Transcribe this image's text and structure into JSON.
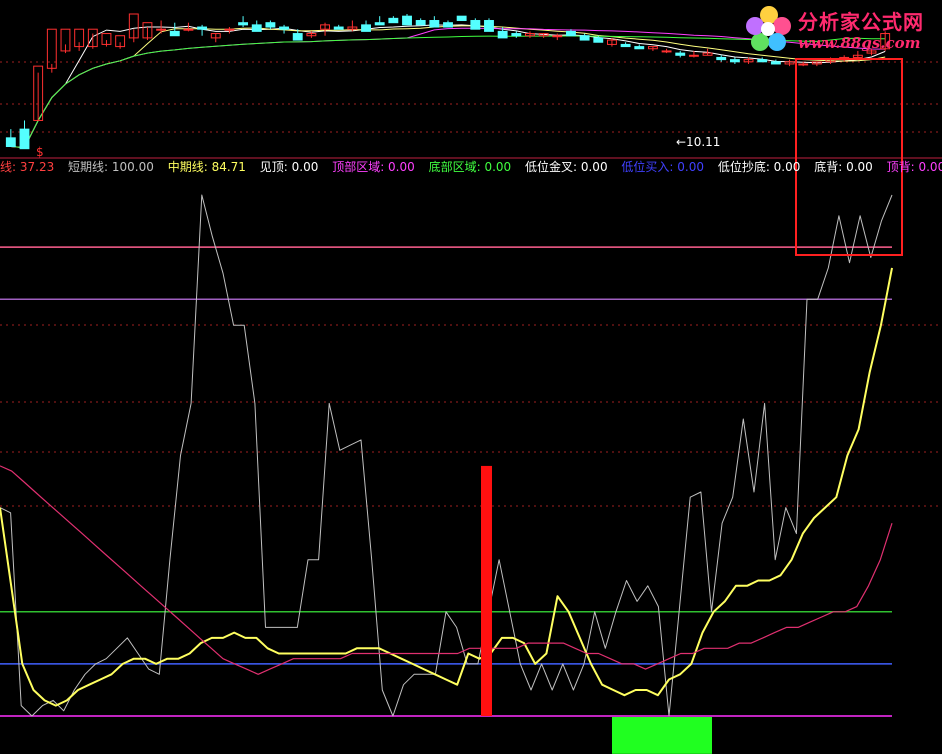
{
  "logo": {
    "title": "分析家公式网",
    "url": "www.88gs.com"
  },
  "colors": {
    "background": "#000000",
    "up_candle": "#ff3030",
    "down_candle": "#54ffff",
    "ma_white": "#ffffff",
    "ma_yellow": "#ffff80",
    "ma_magenta": "#ff40ff",
    "ma_green": "#40ff40",
    "red_box": "#ff2020",
    "separator": "#c02040",
    "grid_dots": "#a02020",
    "line_gray": "#c0c0c0",
    "line_yellow": "#ffff60",
    "line_pink": "#e03070",
    "hline_pink": "#ff6090",
    "hline_purple": "#a060c0",
    "hline_green": "#30c030",
    "hline_blue": "#4060ff",
    "hline_magenta": "#ff30ff",
    "signal_red": "#ff1010",
    "signal_green": "#20ff20"
  },
  "price_panel": {
    "marker_text": "$",
    "low_label": "←10.11"
  },
  "legend": [
    {
      "text": "线: 37.23",
      "color": "#ff4040"
    },
    {
      "text": "短期线: 100.00",
      "color": "#c0c0c0"
    },
    {
      "text": "中期线: 84.71",
      "color": "#ffff60"
    },
    {
      "text": "见顶: 0.00",
      "color": "#ffffff"
    },
    {
      "text": "顶部区域: 0.00",
      "color": "#ff40ff"
    },
    {
      "text": "底部区域: 0.00",
      "color": "#40ff40"
    },
    {
      "text": "低位金叉: 0.00",
      "color": "#ffffff"
    },
    {
      "text": "低位买入: 0.00",
      "color": "#4040ff"
    },
    {
      "text": "低位抄底: 0.00",
      "color": "#ffffff"
    },
    {
      "text": "底背: 0.00",
      "color": "#ffffff"
    },
    {
      "text": "顶背: 0.00",
      "color": "#ff40ff"
    }
  ],
  "chart_data": [
    {
      "type": "candlestick",
      "title": "",
      "notes": "price panel, no visible axis labels",
      "candles": [
        [
          50,
          54,
          49,
          46
        ],
        [
          54,
          58,
          53,
          45
        ],
        [
          58,
          80,
          58,
          83
        ],
        [
          82,
          84,
          80,
          100
        ],
        [
          90,
          93,
          89,
          100
        ],
        [
          92,
          94,
          90,
          100
        ],
        [
          92,
          98,
          91,
          100
        ],
        [
          93,
          95,
          92,
          98
        ],
        [
          92,
          94,
          91,
          97
        ],
        [
          96,
          100,
          94,
          107
        ],
        [
          96,
          101,
          95,
          103
        ],
        [
          100,
          104,
          98,
          100
        ],
        [
          99,
          103,
          98,
          97
        ],
        [
          100,
          103,
          99,
          100
        ],
        [
          101,
          102,
          97,
          100
        ],
        [
          96,
          98,
          94,
          98
        ],
        [
          100,
          101,
          98,
          100
        ],
        [
          103,
          106,
          101,
          102
        ],
        [
          102,
          104,
          101,
          99
        ],
        [
          103,
          104,
          100,
          101
        ],
        [
          101,
          102,
          98,
          100
        ],
        [
          98,
          100,
          97,
          95
        ],
        [
          97,
          99,
          96,
          98
        ],
        [
          100,
          103,
          97,
          102
        ],
        [
          101,
          102,
          100,
          100
        ],
        [
          100,
          104,
          99,
          101
        ],
        [
          102,
          104,
          101,
          99
        ],
        [
          103,
          106,
          102,
          102
        ],
        [
          105,
          106,
          104,
          103
        ],
        [
          106,
          107,
          105,
          102
        ],
        [
          104,
          105,
          103,
          102
        ],
        [
          104,
          106,
          103,
          101
        ],
        [
          103,
          104,
          101,
          101
        ],
        [
          106,
          106,
          104,
          104
        ],
        [
          104,
          105,
          103,
          100
        ],
        [
          104,
          105,
          100,
          99
        ],
        [
          99,
          101,
          97,
          96
        ],
        [
          98,
          99,
          96,
          97
        ],
        [
          97,
          99,
          96,
          98
        ],
        [
          97,
          98,
          96,
          98
        ],
        [
          97,
          98,
          95,
          97
        ],
        [
          99,
          100,
          97,
          97
        ],
        [
          97,
          98,
          96,
          95
        ],
        [
          96,
          97,
          94,
          94
        ],
        [
          93,
          96,
          92,
          95
        ],
        [
          93,
          94,
          92,
          92
        ],
        [
          92,
          93,
          91,
          91
        ],
        [
          91,
          92,
          90,
          92
        ],
        [
          90,
          91,
          89,
          90
        ],
        [
          89,
          90,
          87,
          88
        ],
        [
          88,
          90,
          87,
          88
        ],
        [
          88,
          91,
          88,
          89
        ],
        [
          87,
          88,
          85,
          86
        ],
        [
          86,
          87,
          84,
          85
        ],
        [
          85,
          87,
          84,
          86
        ],
        [
          86,
          87,
          85,
          85
        ],
        [
          85,
          86,
          84,
          84
        ],
        [
          84,
          86,
          83,
          85
        ],
        [
          84,
          85,
          83,
          84
        ],
        [
          84,
          85,
          83,
          85
        ],
        [
          85,
          87,
          84,
          86
        ],
        [
          86,
          88,
          85,
          87
        ],
        [
          87,
          90,
          86,
          88
        ],
        [
          89,
          91,
          88,
          90
        ],
        [
          91,
          99,
          90,
          98
        ]
      ]
    },
    {
      "type": "line",
      "title": "",
      "notes": "oscillator panel, values on a 0-100 scale",
      "hlines": [
        {
          "name": "",
          "value": 90,
          "color": "#ff6090"
        },
        {
          "name": "",
          "value": 80,
          "color": "#a060c0"
        },
        {
          "name": "",
          "value": 20,
          "color": "#30c030"
        },
        {
          "name": "",
          "value": 10,
          "color": "#4060ff"
        },
        {
          "name": "",
          "value": 0,
          "color": "#ff30ff"
        }
      ],
      "series": [
        {
          "name": "短期线",
          "color": "#c0c0c0",
          "values": [
            40,
            39,
            2,
            0,
            2,
            3,
            1,
            5,
            8,
            10,
            11,
            13,
            15,
            12,
            9,
            8,
            30,
            50,
            60,
            100,
            92,
            85,
            75,
            75,
            60,
            17,
            17,
            17,
            17,
            30,
            30,
            60,
            51,
            52,
            53,
            30,
            5,
            0,
            6,
            8,
            8,
            8,
            20,
            17,
            10,
            10,
            20,
            30,
            20,
            10,
            5,
            10,
            5,
            10,
            5,
            10,
            20,
            13,
            20,
            26,
            22,
            25,
            21,
            0,
            21,
            42,
            43,
            20,
            37,
            42,
            57,
            43,
            60,
            30,
            40,
            35,
            80,
            80,
            86,
            96,
            87,
            96,
            88,
            95,
            100
          ]
        },
        {
          "name": "中期线",
          "color": "#ffff60",
          "values": [
            40,
            25,
            10,
            5,
            3,
            2,
            3,
            5,
            6,
            7,
            8,
            10,
            11,
            11,
            10,
            11,
            11,
            12,
            14,
            15,
            15,
            16,
            15,
            15,
            13,
            12,
            12,
            12,
            12,
            12,
            12,
            12,
            13,
            13,
            13,
            12,
            11,
            10,
            9,
            8,
            7,
            6,
            12,
            11,
            12,
            15,
            15,
            14,
            10,
            12,
            23,
            20,
            15,
            10,
            6,
            5,
            4,
            5,
            5,
            4,
            7,
            8,
            10,
            16,
            20,
            22,
            25,
            25,
            26,
            26,
            27,
            30,
            35,
            38,
            40,
            42,
            50,
            55,
            66,
            75,
            86
          ]
        },
        {
          "name": "",
          "color": "#e03070",
          "values": [
            48,
            47,
            45,
            43,
            41,
            39,
            37,
            35,
            33,
            31,
            29,
            27,
            25,
            23,
            21,
            19,
            17,
            15,
            13,
            11,
            10,
            9,
            8,
            9,
            10,
            11,
            11,
            11,
            11,
            11,
            12,
            12,
            12,
            12,
            12,
            12,
            12,
            12,
            12,
            12,
            13,
            13,
            13,
            13,
            13,
            14,
            14,
            14,
            14,
            13,
            12,
            12,
            11,
            10,
            10,
            9,
            10,
            11,
            12,
            12,
            13,
            13,
            13,
            14,
            14,
            15,
            16,
            17,
            17,
            18,
            19,
            20,
            20,
            21,
            25,
            30,
            37
          ]
        }
      ],
      "signals": [
        {
          "name": "低位买入",
          "color": "#ff1010",
          "value": 48
        },
        {
          "name": "底部区域",
          "color": "#20ff20",
          "value": -4
        }
      ]
    }
  ]
}
